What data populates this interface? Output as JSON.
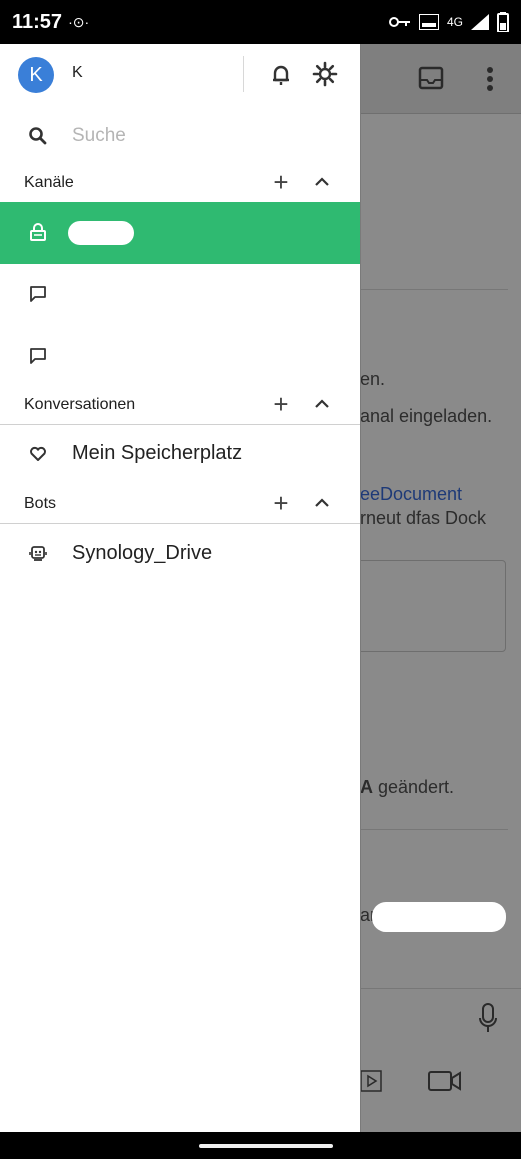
{
  "status_bar": {
    "time": "11:57",
    "indicator": "·⊙·",
    "network": "4G",
    "icons": [
      "key-icon",
      "volte-icon",
      "signal-icon",
      "battery-icon"
    ]
  },
  "background": {
    "text_1": "en.",
    "text_2": "anal eingeladen.",
    "link_1": "eeDocument",
    "text_3": "rneut dfas Dock",
    "text_4_bold": "A",
    "text_4": " geändert.",
    "text_5": "ar",
    "icons": [
      "inbox-icon",
      "more-icon",
      "mic-icon",
      "video-icon",
      "play-icon"
    ]
  },
  "drawer": {
    "user": {
      "avatar_letter": "K",
      "name": "K"
    },
    "search": {
      "placeholder": "Suche"
    },
    "sections": {
      "channels": {
        "label": "Kanäle"
      },
      "conversations": {
        "label": "Konversationen"
      },
      "bots": {
        "label": "Bots"
      }
    },
    "conversation_items": [
      {
        "label": "Mein Speicherplatz",
        "icon": "heart-icon"
      }
    ],
    "bot_items": [
      {
        "label": "Synology_Drive",
        "icon": "bot-icon"
      }
    ]
  },
  "colors": {
    "accent_green": "#2fba71",
    "avatar_blue": "#3a7fd8",
    "scrim": "#8a8a8a"
  }
}
